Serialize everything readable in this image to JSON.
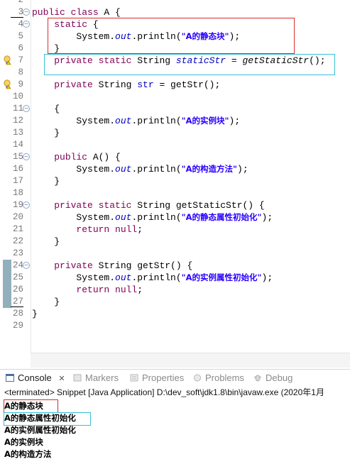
{
  "editor": {
    "lines": [
      {
        "n": "2",
        "tokens": []
      },
      {
        "n": "3",
        "tokens": [
          {
            "t": "public class ",
            "c": "kw"
          },
          {
            "t": "A {",
            "c": ""
          }
        ]
      },
      {
        "n": "4",
        "tokens": [
          {
            "t": "    ",
            "c": ""
          },
          {
            "t": "static",
            "c": "kw"
          },
          {
            "t": " {",
            "c": ""
          }
        ]
      },
      {
        "n": "5",
        "tokens": [
          {
            "t": "        System.",
            "c": ""
          },
          {
            "t": "out",
            "c": "it"
          },
          {
            "t": ".println(",
            "c": ""
          },
          {
            "t": "\"A的静态块\"",
            "c": "str"
          },
          {
            "t": ");",
            "c": ""
          }
        ]
      },
      {
        "n": "6",
        "tokens": [
          {
            "t": "    }",
            "c": ""
          }
        ]
      },
      {
        "n": "7",
        "tokens": [
          {
            "t": "    ",
            "c": ""
          },
          {
            "t": "private static",
            "c": "kw"
          },
          {
            "t": " String ",
            "c": ""
          },
          {
            "t": "staticStr",
            "c": "it"
          },
          {
            "t": " = ",
            "c": ""
          },
          {
            "t": "getStaticStr",
            "c": "itb"
          },
          {
            "t": "();",
            "c": ""
          }
        ]
      },
      {
        "n": "8",
        "tokens": []
      },
      {
        "n": "9",
        "tokens": [
          {
            "t": "    ",
            "c": ""
          },
          {
            "t": "private",
            "c": "kw"
          },
          {
            "t": " String ",
            "c": ""
          },
          {
            "t": "str",
            "c": "field"
          },
          {
            "t": " = getStr();",
            "c": ""
          }
        ]
      },
      {
        "n": "10",
        "tokens": []
      },
      {
        "n": "11",
        "tokens": [
          {
            "t": "    {",
            "c": ""
          }
        ]
      },
      {
        "n": "12",
        "tokens": [
          {
            "t": "        System.",
            "c": ""
          },
          {
            "t": "out",
            "c": "it"
          },
          {
            "t": ".println(",
            "c": ""
          },
          {
            "t": "\"A的实例块\"",
            "c": "str"
          },
          {
            "t": ");",
            "c": ""
          }
        ]
      },
      {
        "n": "13",
        "tokens": [
          {
            "t": "    }",
            "c": ""
          }
        ]
      },
      {
        "n": "14",
        "tokens": []
      },
      {
        "n": "15",
        "tokens": [
          {
            "t": "    ",
            "c": ""
          },
          {
            "t": "public",
            "c": "kw"
          },
          {
            "t": " A() {",
            "c": ""
          }
        ]
      },
      {
        "n": "16",
        "tokens": [
          {
            "t": "        System.",
            "c": ""
          },
          {
            "t": "out",
            "c": "it"
          },
          {
            "t": ".println(",
            "c": ""
          },
          {
            "t": "\"A的构造方法\"",
            "c": "str"
          },
          {
            "t": ");",
            "c": ""
          }
        ]
      },
      {
        "n": "17",
        "tokens": [
          {
            "t": "    }",
            "c": ""
          }
        ]
      },
      {
        "n": "18",
        "tokens": []
      },
      {
        "n": "19",
        "tokens": [
          {
            "t": "    ",
            "c": ""
          },
          {
            "t": "private static",
            "c": "kw"
          },
          {
            "t": " String getStaticStr() {",
            "c": ""
          }
        ]
      },
      {
        "n": "20",
        "tokens": [
          {
            "t": "        System.",
            "c": ""
          },
          {
            "t": "out",
            "c": "it"
          },
          {
            "t": ".println(",
            "c": ""
          },
          {
            "t": "\"A的静态属性初始化\"",
            "c": "str"
          },
          {
            "t": ");",
            "c": ""
          }
        ]
      },
      {
        "n": "21",
        "tokens": [
          {
            "t": "        ",
            "c": ""
          },
          {
            "t": "return null",
            "c": "kw"
          },
          {
            "t": ";",
            "c": ""
          }
        ]
      },
      {
        "n": "22",
        "tokens": [
          {
            "t": "    }",
            "c": ""
          }
        ]
      },
      {
        "n": "23",
        "tokens": []
      },
      {
        "n": "24",
        "tokens": [
          {
            "t": "    ",
            "c": ""
          },
          {
            "t": "private",
            "c": "kw"
          },
          {
            "t": " String getStr() {",
            "c": ""
          }
        ]
      },
      {
        "n": "25",
        "tokens": [
          {
            "t": "        System.",
            "c": ""
          },
          {
            "t": "out",
            "c": "it"
          },
          {
            "t": ".println(",
            "c": ""
          },
          {
            "t": "\"A的实例属性初始化\"",
            "c": "str"
          },
          {
            "t": ");",
            "c": ""
          }
        ]
      },
      {
        "n": "26",
        "tokens": [
          {
            "t": "        ",
            "c": ""
          },
          {
            "t": "return null",
            "c": "kw"
          },
          {
            "t": ";",
            "c": ""
          }
        ]
      },
      {
        "n": "27",
        "tokens": [
          {
            "t": "    }",
            "c": ""
          }
        ]
      },
      {
        "n": "28",
        "tokens": [
          {
            "t": "}",
            "c": ""
          }
        ]
      },
      {
        "n": "29",
        "tokens": []
      }
    ],
    "fold_lines": [
      "3",
      "4",
      "11",
      "15",
      "19",
      "24"
    ],
    "warning_lines": [
      "7",
      "9"
    ],
    "change_marker_lines": [
      "24",
      "25",
      "26",
      "27"
    ]
  },
  "tabs": {
    "console": "Console",
    "close_glyph": "✕",
    "markers": "Markers",
    "properties": "Properties",
    "problems": "Problems",
    "debug": "Debug"
  },
  "console": {
    "terminated": "<terminated> Snippet [Java Application] D:\\dev_soft\\jdk1.8\\bin\\javaw.exe (2020年1月",
    "output": [
      "A的静态块",
      "A的静态属性初始化",
      "A的实例属性初始化",
      "A的实例块",
      "A的构造方法"
    ]
  },
  "colors": {
    "keyword": "#7f0055",
    "string": "#2a00ff",
    "field": "#0000c0",
    "highlight_red": "#d62e2e",
    "highlight_cyan": "#36c1d6"
  }
}
